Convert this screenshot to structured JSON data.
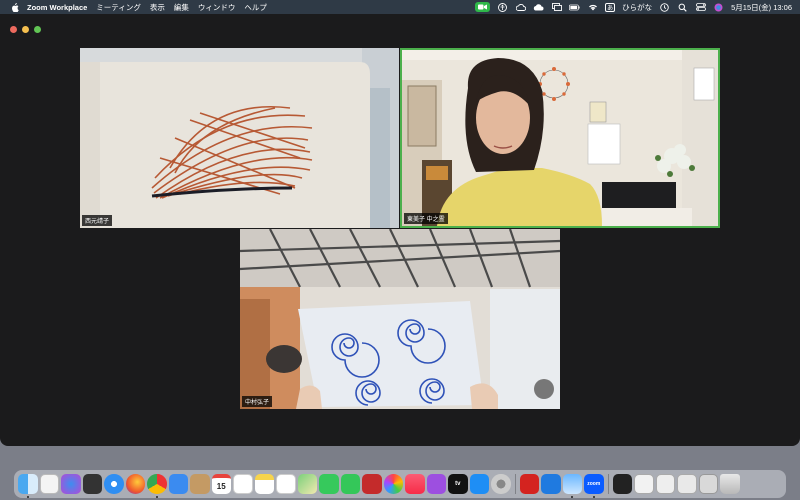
{
  "menubar": {
    "app_name": "Zoom Workplace",
    "menus": [
      "ミーティング",
      "表示",
      "編集",
      "ウィンドウ",
      "ヘルプ"
    ],
    "input_method_badge": "あ",
    "input_method": "ひらがな",
    "datetime": "5月15日(金)  13:06"
  },
  "participants": [
    {
      "name": "西元靖子"
    },
    {
      "name": "東美子 中之霊"
    },
    {
      "name": "中村弘子"
    }
  ],
  "dock": {
    "zoom_label": "zoom",
    "calendar_day": "15",
    "appletv_label": "tv"
  },
  "colors": {
    "speaker_highlight": "#4cb04c",
    "menubar_bg": "#2f3a46",
    "window_bg": "#1b1b1c",
    "zoom_status_green": "#2fb84a"
  }
}
